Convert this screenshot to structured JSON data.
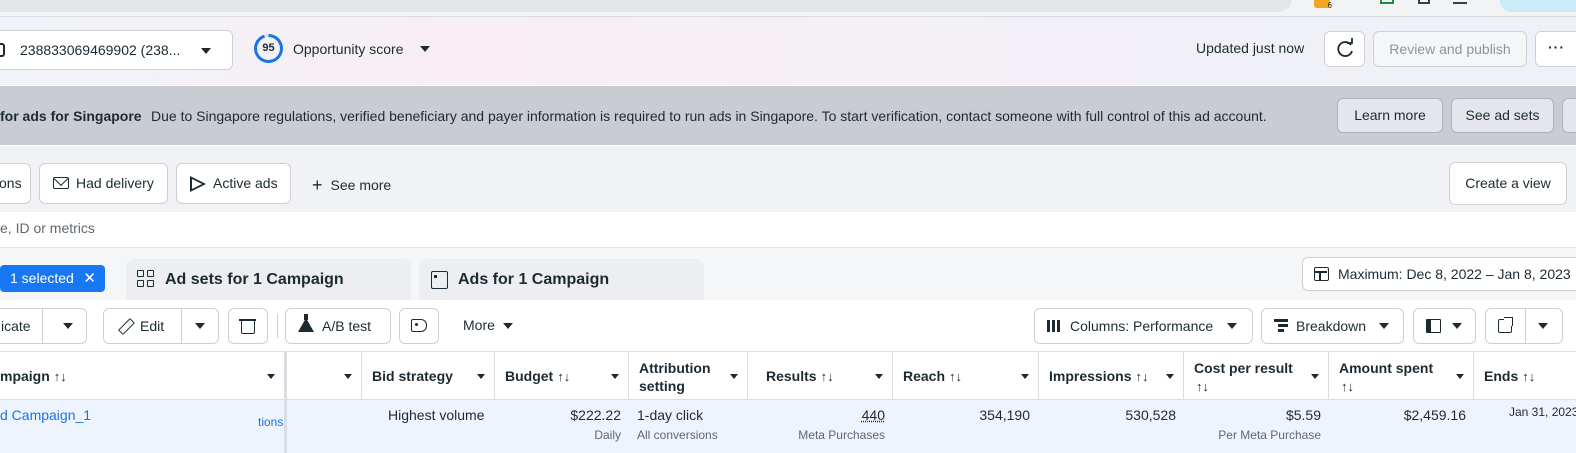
{
  "header": {
    "account_label": "238833069469902 (238...",
    "opportunity_score": "95",
    "opportunity_label": "Opportunity score",
    "updated_text": "Updated just now",
    "review_publish_label": "Review and publish",
    "more_label": "···"
  },
  "banner": {
    "title": "for ads for Singapore",
    "message": "Due to Singapore regulations, verified beneficiary and payer information is required to run ads in Singapore. To start verification, contact someone with full control of this ad account.",
    "learn_more": "Learn more",
    "see_ad_sets": "See ad sets"
  },
  "filters": {
    "chip_cut": "ons",
    "had_delivery": "Had delivery",
    "active_ads": "Active ads",
    "see_more": "See more",
    "create_view": "Create a view"
  },
  "search": {
    "placeholder": "e, ID or metrics"
  },
  "tabs": {
    "selected_label": "1 selected",
    "adsets_label": "Ad sets for 1 Campaign",
    "ads_label": "Ads for 1 Campaign",
    "date_range": "Maximum: Dec 8, 2022 – Jan 8, 2023"
  },
  "toolbar": {
    "duplicate_cut": "icate",
    "edit_label": "Edit",
    "ab_test_label": "A/B test",
    "more_label": "More",
    "columns_label": "Columns: Performance",
    "breakdown_label": "Breakdown"
  },
  "table": {
    "headers": {
      "campaign": "mpaign",
      "bid_strategy": "Bid strategy",
      "budget": "Budget",
      "attribution": "Attribution setting",
      "results": "Results",
      "reach": "Reach",
      "impressions": "Impressions",
      "cost_per_result": "Cost per result",
      "amount_spent": "Amount spent",
      "ends": "Ends"
    },
    "sort_glyph": "↑↓",
    "row": {
      "campaign_name": "d Campaign_1",
      "status_cut": "tions",
      "bid_strategy": "Highest volume",
      "budget": "$222.22",
      "budget_sub": "Daily",
      "attribution": "1-day click",
      "attribution_sub": "All conversions",
      "results": "440",
      "results_sub": "Meta Purchases",
      "reach": "354,190",
      "impressions": "530,528",
      "cost_per_result": "$5.59",
      "cost_sub": "Per Meta Purchase",
      "amount_spent": "$2,459.16",
      "ends": "Jan 31, 2023"
    }
  },
  "colors": {
    "brand_blue": "#1877f2",
    "link_blue": "#1b74e4",
    "banner_bg": "#c9ccd1",
    "row_selected_bg": "#eef4fd"
  },
  "icons": [
    "close-icon",
    "envelope-icon",
    "send-icon",
    "plus-icon",
    "grid-icon",
    "document-icon",
    "calendar-icon",
    "pencil-icon",
    "trash-icon",
    "flask-icon",
    "tag-icon",
    "columns-icon",
    "breakdown-icon",
    "reports-icon",
    "export-icon",
    "refresh-icon"
  ]
}
